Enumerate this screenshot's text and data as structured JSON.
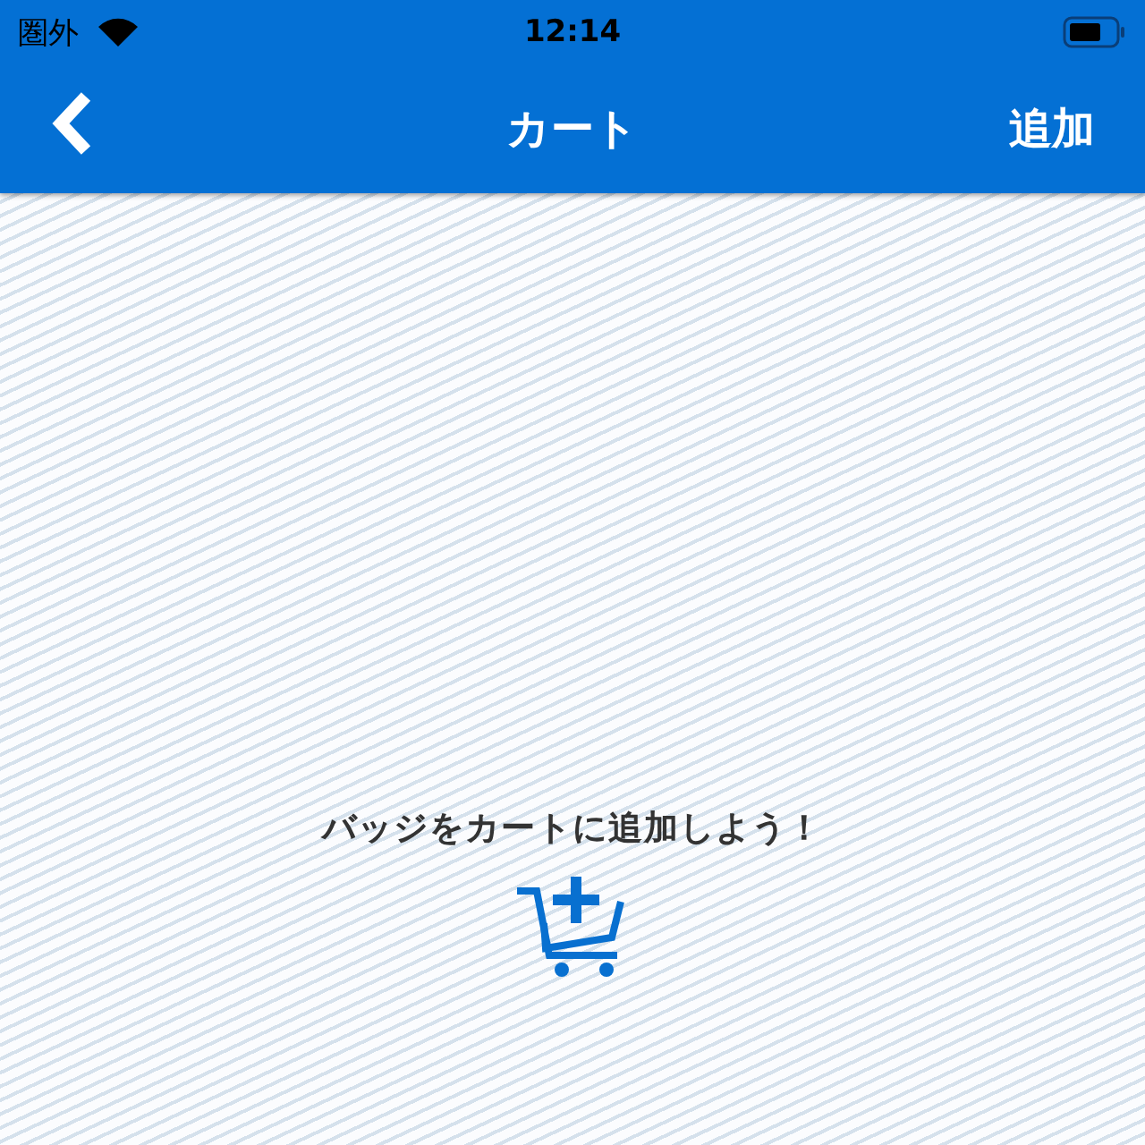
{
  "status_bar": {
    "carrier": "圏外",
    "time": "12:14"
  },
  "nav_bar": {
    "title": "カート",
    "action": "追加"
  },
  "empty_state": {
    "message": "バッジをカートに追加しよう！"
  }
}
